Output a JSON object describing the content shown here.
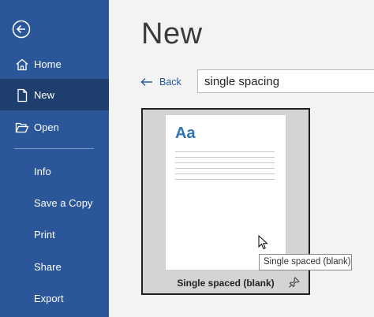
{
  "page": {
    "title": "New"
  },
  "sidebar": {
    "items": [
      {
        "label": "Home",
        "icon": "home-icon"
      },
      {
        "label": "New",
        "icon": "document-icon",
        "active": true
      },
      {
        "label": "Open",
        "icon": "folder-open-icon"
      },
      {
        "label": "Info"
      },
      {
        "label": "Save a Copy"
      },
      {
        "label": "Print"
      },
      {
        "label": "Share"
      },
      {
        "label": "Export"
      }
    ]
  },
  "search": {
    "back_label": "Back",
    "value": "single spacing"
  },
  "template": {
    "thumbnail_text": "Aa",
    "caption": "Single spaced (blank)",
    "tooltip": "Single spaced (blank)"
  },
  "colors": {
    "sidebar": "#2b579a",
    "sidebar_active": "#1e3e6e",
    "accent": "#2e74b5"
  }
}
